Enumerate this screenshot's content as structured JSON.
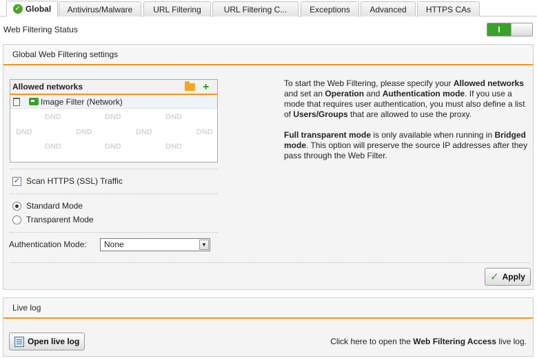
{
  "tabs": [
    {
      "label": "Global",
      "icon": "check-icon"
    },
    {
      "label": "Antivirus/Malware"
    },
    {
      "label": "URL Filtering"
    },
    {
      "label": "URL Filtering C..."
    },
    {
      "label": "Exceptions"
    },
    {
      "label": "Advanced"
    },
    {
      "label": "HTTPS CAs"
    }
  ],
  "status": {
    "label": "Web Filtering Status",
    "toggle_state": "I"
  },
  "settings": {
    "title": "Global Web Filtering settings",
    "allowed_networks": {
      "header": "Allowed networks",
      "items": [
        {
          "label": "Image Filter (Network)"
        }
      ],
      "dnd_text": "DND"
    },
    "scan_https": {
      "label": "Scan HTTPS (SSL) Traffic",
      "checked": true
    },
    "modes": [
      {
        "label": "Standard Mode",
        "checked": true
      },
      {
        "label": "Transparent Mode",
        "checked": false
      }
    ],
    "auth": {
      "label": "Authentication Mode:",
      "value": "None"
    },
    "help": {
      "p1": [
        {
          "t": "To start the Web Filtering, please specify your ",
          "b": false
        },
        {
          "t": "Allowed networks",
          "b": true
        },
        {
          "t": " and set an ",
          "b": false
        },
        {
          "t": "Operation",
          "b": true
        },
        {
          "t": " and ",
          "b": false
        },
        {
          "t": "Authentication mode",
          "b": true
        },
        {
          "t": ". If you use a mode that requires user authentication, you must also define a list of ",
          "b": false
        },
        {
          "t": "Users/Groups",
          "b": true
        },
        {
          "t": " that are allowed to use the proxy.",
          "b": false
        }
      ],
      "p2": [
        {
          "t": "Full transparent mode",
          "b": true
        },
        {
          "t": " is only available when running in ",
          "b": false
        },
        {
          "t": "Bridged mode",
          "b": true
        },
        {
          "t": ". This option will preserve the source IP addresses after they pass through the Web Filter.",
          "b": false
        }
      ]
    },
    "apply_label": "Apply"
  },
  "livelog": {
    "title": "Live log",
    "button_label": "Open live log",
    "text_before": "Click here to open the ",
    "text_bold": "Web Filtering Access",
    "text_after": " live log."
  },
  "colors": {
    "accent": "#f0951c",
    "toggle_on": "#3aa12a",
    "check_green": "#2f9a1f"
  }
}
